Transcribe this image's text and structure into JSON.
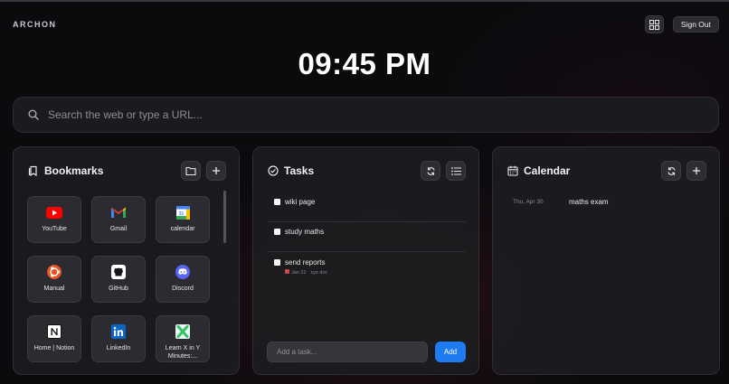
{
  "app": {
    "brand": "ARCHON"
  },
  "header": {
    "sign_out_label": "Sign Out"
  },
  "clock": {
    "time": "09:45 PM"
  },
  "search": {
    "placeholder": "Search the web or type a URL..."
  },
  "bookmarks": {
    "title": "Bookmarks",
    "items": [
      {
        "label": "YouTube",
        "icon": "youtube-icon"
      },
      {
        "label": "Gmail",
        "icon": "gmail-icon"
      },
      {
        "label": "calendar",
        "icon": "google-calendar-icon"
      },
      {
        "label": "Manual",
        "icon": "ubuntu-icon"
      },
      {
        "label": "GitHub",
        "icon": "github-icon"
      },
      {
        "label": "Discord",
        "icon": "discord-icon"
      },
      {
        "label": "Home | Notion",
        "icon": "notion-icon"
      },
      {
        "label": "LinkedIn",
        "icon": "linkedin-icon"
      },
      {
        "label": "Learn X in Y Minutes:...",
        "icon": "learnx-icon"
      }
    ]
  },
  "tasks": {
    "title": "Tasks",
    "items": [
      {
        "text": "wiki page",
        "date": "",
        "note": ""
      },
      {
        "text": "study maths",
        "date": "",
        "note": ""
      },
      {
        "text": "send reports",
        "date": "Jan 22",
        "note": "xyz doc"
      }
    ],
    "add_placeholder": "Add a task...",
    "add_label": "Add"
  },
  "calendar": {
    "title": "Calendar",
    "events": [
      {
        "date": "Thu, Apr 30",
        "name": "maths exam"
      }
    ]
  },
  "colors": {
    "accent": "#1f7bf2",
    "panel": "#1c1c20",
    "background": "#0b0b0e"
  }
}
